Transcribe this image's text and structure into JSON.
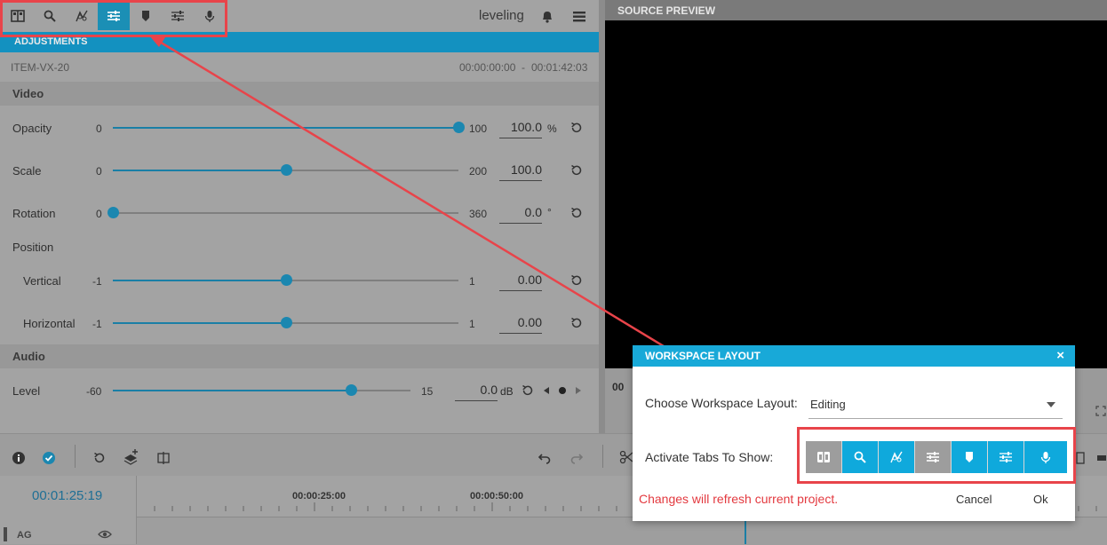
{
  "left_toolbar": {
    "icons": [
      "media-icon",
      "search-icon",
      "effects-icon",
      "adjustments-icon",
      "marker-icon",
      "audio-mixer-icon",
      "microphone-icon"
    ],
    "active_index": 3,
    "project_name": "leveling"
  },
  "adjustments": {
    "title": "ADJUSTMENTS",
    "item_name": "ITEM-VX-20",
    "start_time": "00:00:00:00",
    "separator": "-",
    "end_time": "00:01:42:03",
    "video_section": "Video",
    "audio_section": "Audio",
    "position_label": "Position",
    "params": [
      {
        "label": "Opacity",
        "min": "0",
        "max": "100",
        "value": "100.0",
        "unit": "%",
        "level": 1.0
      },
      {
        "label": "Scale",
        "min": "0",
        "max": "200",
        "value": "100.0",
        "unit": "",
        "level": 0.5
      },
      {
        "label": "Rotation",
        "min": "0",
        "max": "360",
        "value": "0.0",
        "unit": "°",
        "level": 0.0
      },
      {
        "label": "Vertical",
        "min": "-1",
        "max": "1",
        "value": "0.00",
        "unit": "",
        "level": 0.5
      },
      {
        "label": "Horizontal",
        "min": "-1",
        "max": "1",
        "value": "0.00",
        "unit": "",
        "level": 0.5
      }
    ],
    "audio_level": {
      "label": "Level",
      "min": "-60",
      "max": "15",
      "value": "0.0",
      "unit": "dB",
      "level": 0.8
    }
  },
  "preview": {
    "title": "SOURCE PREVIEW",
    "time_partial": "00"
  },
  "timeline": {
    "timecode": "00:01:25:19",
    "ruler_labels": [
      "00:00:25:00",
      "00:00:50:00"
    ],
    "track_name": "AG"
  },
  "dialog": {
    "title": "WORKSPACE LAYOUT",
    "close_symbol": "×",
    "layout_label": "Choose Workspace Layout:",
    "layout_value": "Editing",
    "tabs_label": "Activate Tabs To Show:",
    "tabs": [
      {
        "icon": "media-icon",
        "enabled": false
      },
      {
        "icon": "search-icon",
        "enabled": true
      },
      {
        "icon": "effects-icon",
        "enabled": true
      },
      {
        "icon": "adjustments-icon",
        "enabled": false
      },
      {
        "icon": "marker-icon",
        "enabled": true
      },
      {
        "icon": "audio-mixer-icon",
        "enabled": true
      },
      {
        "icon": "microphone-icon",
        "enabled": true
      }
    ],
    "warning": "Changes will refresh current project.",
    "cancel_label": "Cancel",
    "ok_label": "Ok"
  },
  "colors": {
    "accent": "#1391c0",
    "dialog_accent": "#18a9d8",
    "highlight": "#e8444a",
    "warning": "#e3393f"
  }
}
